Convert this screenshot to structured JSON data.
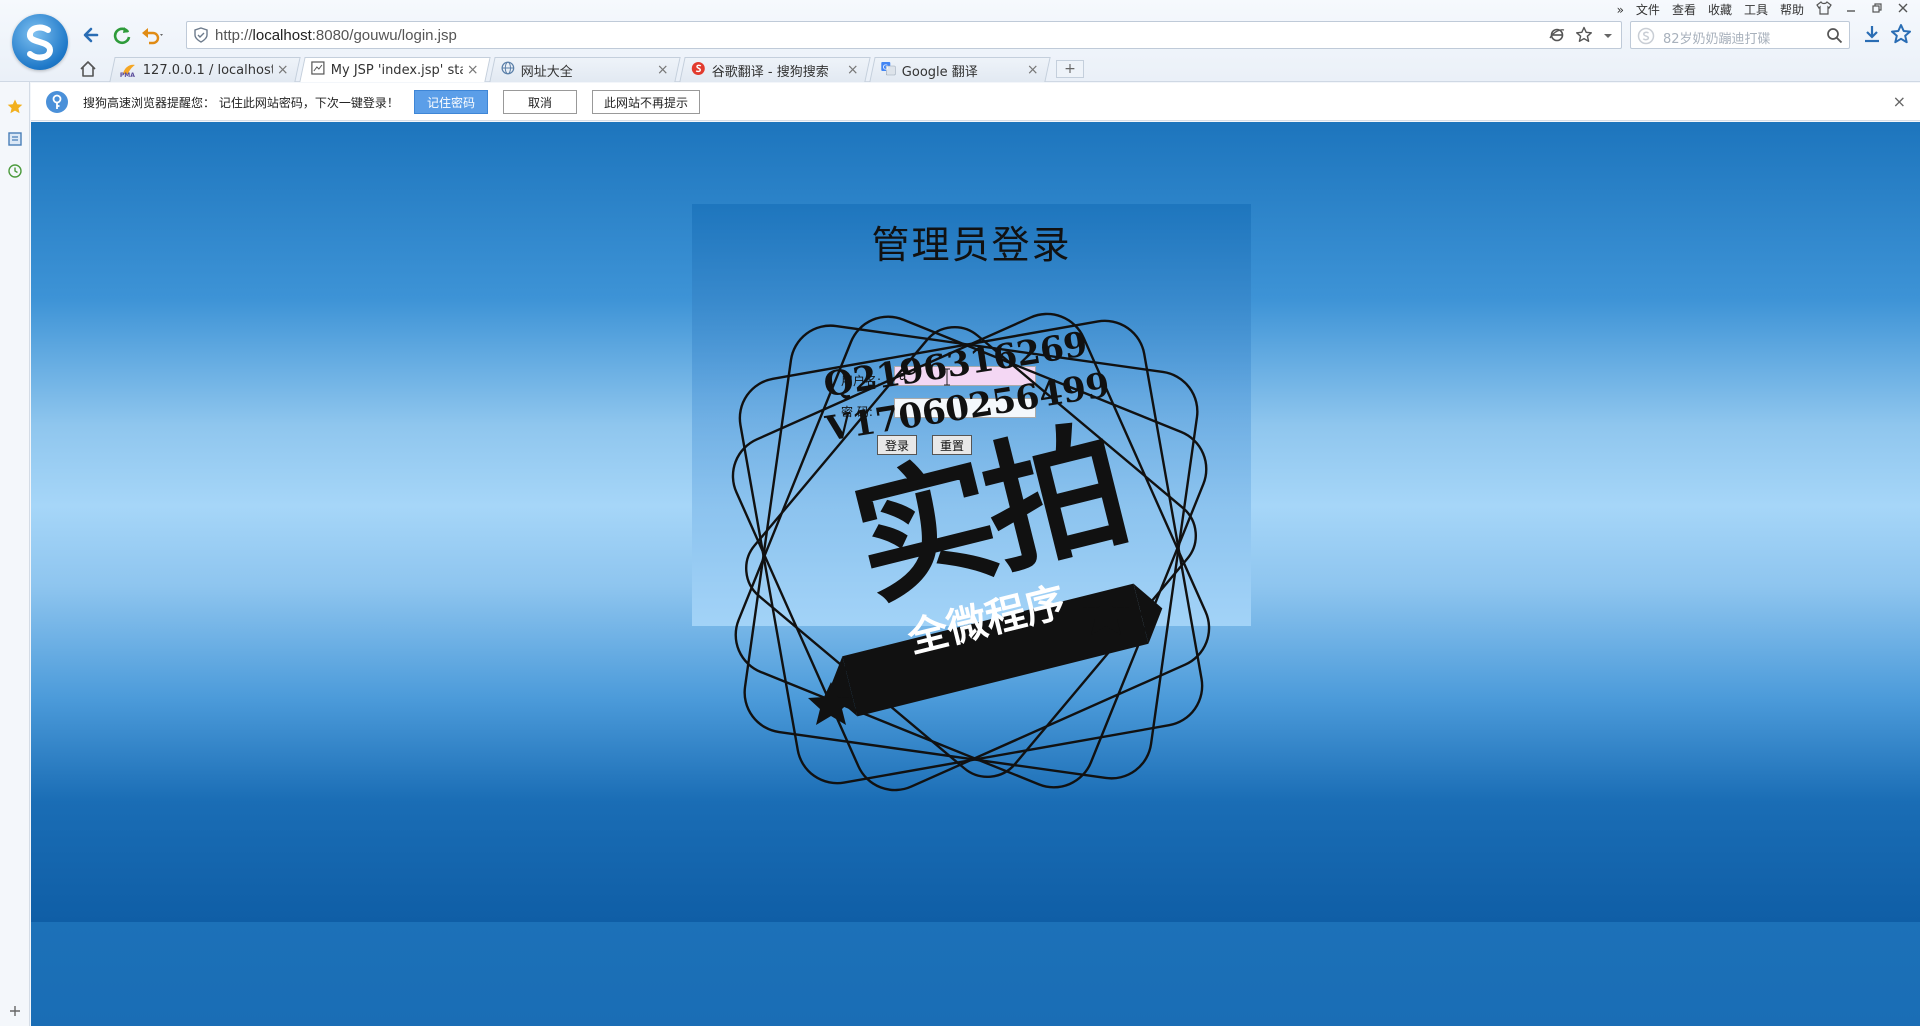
{
  "browser": {
    "url_prefix": "http://",
    "url_host": "localhost",
    "url_rest": ":8080/gouwu/login.jsp",
    "search_placeholder": "82岁奶奶蹦迪打碟",
    "menu": [
      "文件",
      "查看",
      "收藏",
      "工具",
      "帮助"
    ],
    "more_glyph": "»",
    "new_tab": "+",
    "tabs": [
      {
        "label": "127.0.0.1 / localhost /",
        "icon": "phpmyadmin-icon",
        "active": false
      },
      {
        "label": "My JSP 'index.jsp' star",
        "icon": "page-icon",
        "active": true
      },
      {
        "label": "网址大全",
        "icon": "globe-icon",
        "active": false
      },
      {
        "label": "谷歌翻译 - 搜狗搜索",
        "icon": "sogou-icon",
        "active": false
      },
      {
        "label": "Google 翻译",
        "icon": "translate-icon",
        "active": false
      }
    ],
    "tab_close": "×",
    "phpmyadmin_badge": "PMA"
  },
  "notification": {
    "text": "搜狗高速浏览器提醒您：  记住此网站密码，下次一键登录！",
    "remember": "记住密码",
    "cancel": "取消",
    "never": "此网站不再提示",
    "close": "×"
  },
  "login": {
    "title": "管理员登录",
    "username_label": "用户名:",
    "username_value": "a",
    "password_label": "密 码:",
    "submit": "登录",
    "reset": "重置"
  },
  "watermark": {
    "line1": "Q2196316269",
    "line2": "V17060256499",
    "big": "实拍",
    "banner": "全微程序"
  },
  "colors": {
    "page_blue": "#1a6fb7",
    "accent": "#5b9ee8",
    "username_bg": "#f4d7f4"
  }
}
